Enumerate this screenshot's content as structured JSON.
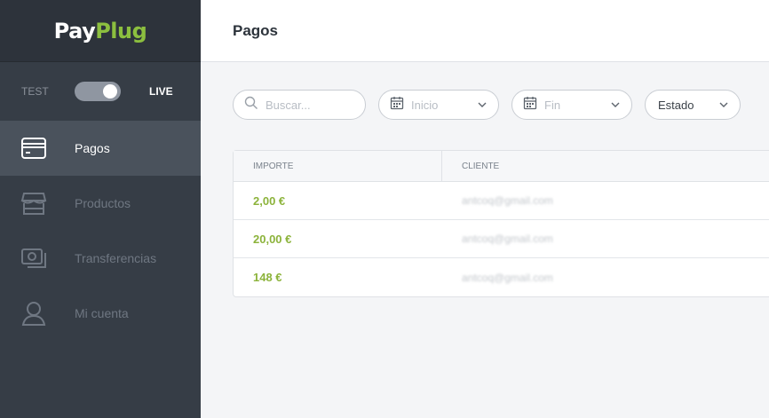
{
  "brand": {
    "pay": "Pay",
    "plug": "Plug"
  },
  "mode": {
    "test_label": "TEST",
    "live_label": "LIVE",
    "is_live": true
  },
  "sidebar": {
    "items": [
      {
        "label": "Pagos",
        "icon": "card-icon",
        "active": true
      },
      {
        "label": "Productos",
        "icon": "store-icon",
        "active": false
      },
      {
        "label": "Transferencias",
        "icon": "cash-icon",
        "active": false
      },
      {
        "label": "Mi cuenta",
        "icon": "user-icon",
        "active": false
      }
    ]
  },
  "header": {
    "title": "Pagos"
  },
  "filters": {
    "search_placeholder": "Buscar...",
    "start_placeholder": "Inicio",
    "end_placeholder": "Fin",
    "status_label": "Estado"
  },
  "table": {
    "columns": [
      "IMPORTE",
      "CLIENTE"
    ],
    "rows": [
      {
        "amount": "2,00 €",
        "client": "antcoq@gmail.com"
      },
      {
        "amount": "20,00 €",
        "client": "antcoq@gmail.com"
      },
      {
        "amount": "148 €",
        "client": "antcoq@gmail.com"
      }
    ]
  },
  "colors": {
    "accent": "#8cbf3f",
    "sidebar": "#363d46",
    "sidebar_active": "#4a525c"
  }
}
